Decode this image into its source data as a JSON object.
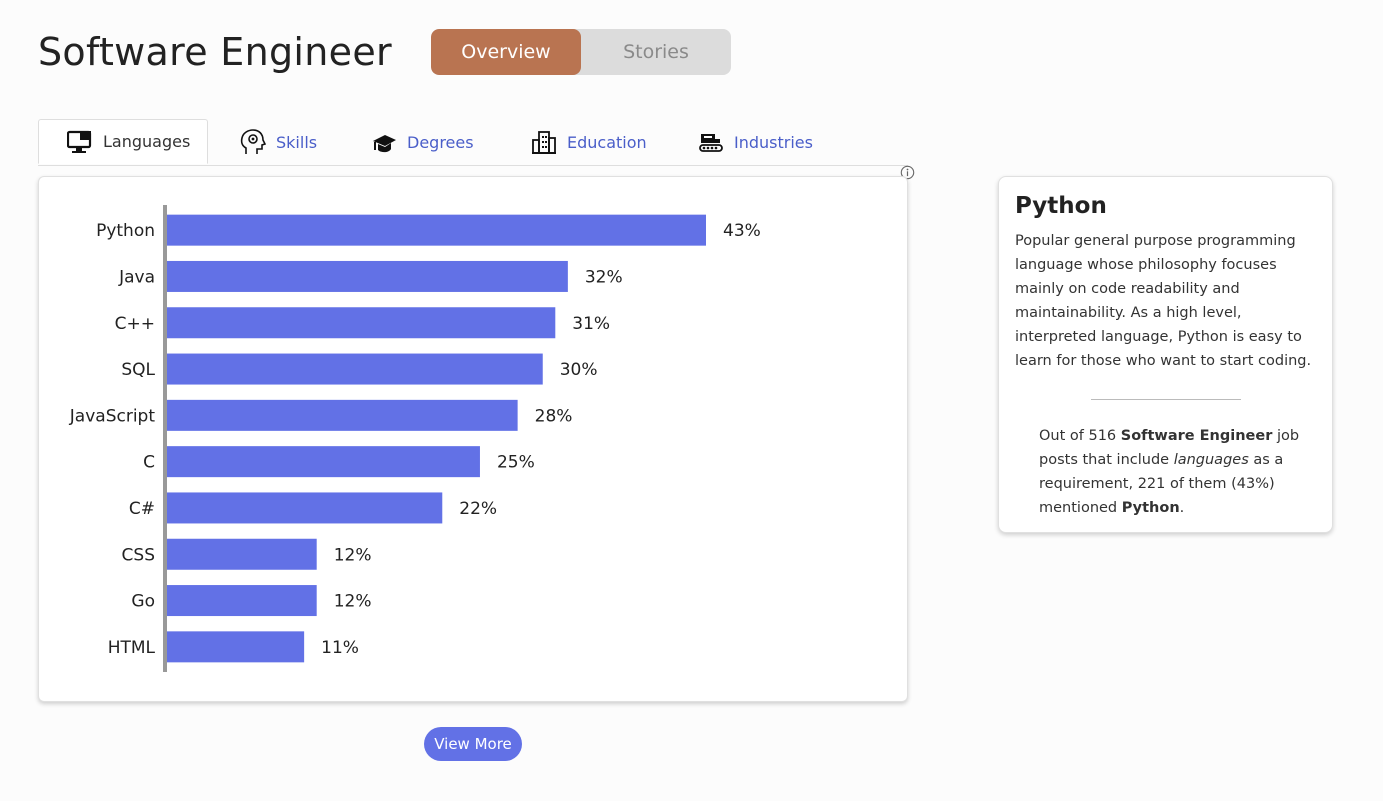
{
  "header": {
    "title": "Software Engineer",
    "toggle": {
      "options": [
        "Overview",
        "Stories"
      ],
      "active": "Overview"
    }
  },
  "tabs": [
    {
      "label": "Languages",
      "icon": "monitor-icon",
      "active": true
    },
    {
      "label": "Skills",
      "icon": "head-gear-icon",
      "active": false
    },
    {
      "label": "Degrees",
      "icon": "graduation-cap-icon",
      "active": false
    },
    {
      "label": "Education",
      "icon": "building-icon",
      "active": false
    },
    {
      "label": "Industries",
      "icon": "factory-icon",
      "active": false
    }
  ],
  "chart_data": {
    "type": "bar",
    "orientation": "horizontal",
    "categories": [
      "Python",
      "Java",
      "C++",
      "SQL",
      "JavaScript",
      "C",
      "C#",
      "CSS",
      "Go",
      "HTML"
    ],
    "values": [
      43,
      32,
      31,
      30,
      28,
      25,
      22,
      12,
      12,
      11
    ],
    "value_suffix": "%",
    "xlim": [
      0,
      55
    ],
    "grid": false,
    "bar_color": "#6271e6",
    "axis_color": "#999999"
  },
  "view_more_label": "View More",
  "detail": {
    "title": "Python",
    "description": "Popular general purpose programming language whose philosophy focuses mainly on code readability and maintainability. As a high level, interpreted language, Python is easy to learn for those who want to start coding.",
    "stat": {
      "prefix": "Out of 516 ",
      "role": "Software Engineer",
      "mid1": " job posts that include ",
      "category": "languages",
      "mid2": " as a requirement, 221 of them (43%) mentioned ",
      "language": "Python",
      "suffix": "."
    }
  },
  "colors": {
    "accent": "#b97451",
    "bar": "#6271e6",
    "tab_link": "#4a5ec9"
  }
}
